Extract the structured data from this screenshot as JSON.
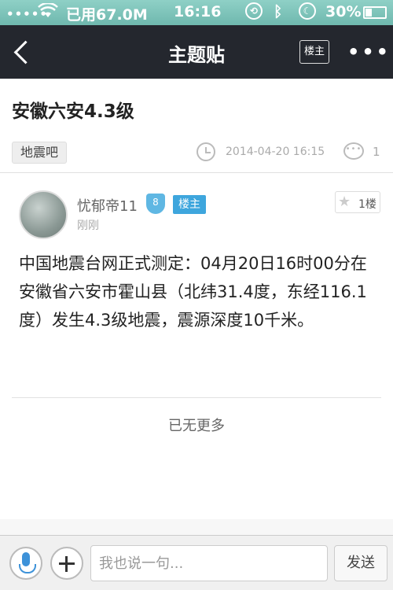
{
  "status_bar": {
    "signal": "•••••",
    "data_usage": "已用67.0M",
    "time": "16:16",
    "battery": "30%"
  },
  "nav": {
    "title": "主题贴",
    "owner_toggle": "楼主",
    "more": "•••"
  },
  "thread": {
    "title": "安徽六安4.3级",
    "forum_tag": "地震吧",
    "date": "2014-04-20 16:15",
    "comment_count": "1"
  },
  "post": {
    "username": "忧郁帝11",
    "level": "8",
    "owner_badge": "楼主",
    "time": "刚刚",
    "floor": "1楼",
    "body": "中国地震台网正式测定：04月20日16时00分在安徽省六安市霍山县（北纬31.4度，东经116.1度）发生4.3级地震，震源深度10千米。"
  },
  "footer_text": "已无更多",
  "reply_bar": {
    "placeholder": "我也说一句...",
    "send_label": "发送"
  },
  "icons": {
    "back": "back-chevron-icon",
    "clock": "clock-icon",
    "comment": "comment-bubble-icon",
    "star": "star-icon",
    "mic": "microphone-icon",
    "add": "plus-icon"
  },
  "colors": {
    "nav_bg": "#24272e",
    "badge_blue": "#3ea6dd",
    "status_bar": "#7cc3b9"
  }
}
